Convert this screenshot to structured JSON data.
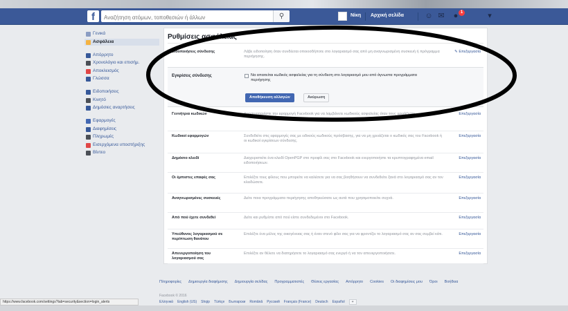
{
  "header": {
    "logo": "f",
    "search_placeholder": "Αναζήτηση ατόμων, τοποθεσιών ή άλλων",
    "search_icon": "⚲",
    "user_name": "Νίκη",
    "home_label": "Αρχική σελίδα",
    "notification_count": "1",
    "friends_icon": "☺",
    "messages_icon": "✉",
    "notifications_icon": "●",
    "lock_icon": "▾",
    "colors": {
      "bar": "#3b5998",
      "badge": "#fa3e3e"
    }
  },
  "leftnav": {
    "groups": [
      {
        "items": [
          {
            "label": "Γενικά",
            "color": "#8b9dc3"
          },
          {
            "label": "Ασφάλεια",
            "color": "#f5b341",
            "active": true
          }
        ]
      },
      {
        "items": [
          {
            "label": "Απόρρητο",
            "color": "#365899"
          },
          {
            "label": "Χρονολόγιο και επισήμ.",
            "color": "#4b4f56"
          },
          {
            "label": "Αποκλεισμός",
            "color": "#e04646"
          },
          {
            "label": "Γλώσσα",
            "color": "#365899"
          }
        ]
      },
      {
        "items": [
          {
            "label": "Ειδοποιήσεις",
            "color": "#365899"
          },
          {
            "label": "Κινητό",
            "color": "#4b4f56"
          },
          {
            "label": "Δημόσιες αναρτήσεις",
            "color": "#365899"
          }
        ]
      },
      {
        "items": [
          {
            "label": "Εφαρμογές",
            "color": "#4267b2"
          },
          {
            "label": "Διαφημίσεις",
            "color": "#365899"
          },
          {
            "label": "Πληρωμές",
            "color": "#4b4f56"
          },
          {
            "label": "Εισερχόμενα υποστήριξης",
            "color": "#e04646"
          },
          {
            "label": "Βίντεο",
            "color": "#4b4f56"
          }
        ]
      }
    ]
  },
  "main": {
    "title": "Ρυθμίσεις ασφάλειας",
    "edit_label": "Επεξεργασία",
    "top_row": {
      "label": "Ειδοποιήσεις σύνδεσης",
      "description": "Λάβε ειδοποίηση όταν συνδέεται οποιοσδήποτε στο λογαριασμό σας από μη αναγνωρισμένη συσκευή ή πρόγραμμα περιήγησης."
    },
    "expanded": {
      "label": "Εγκρίσεις σύνδεσης",
      "checkbox_text": "Να απαιτείται κωδικός ασφαλείας για τη σύνδεση στο λογαριασμό μου από άγνωστα προγράμματα περιήγησης",
      "save_label": "Αποθήκευση αλλαγών",
      "cancel_label": "Ακύρωση"
    },
    "rows": [
      {
        "label": "Γεννήτρια κωδικών",
        "description": "Χρησιμοποιήστε την εφαρμογή Facebook για να λαμβάνετε κωδικούς ασφαλείας όταν τους χρειάζεστε."
      },
      {
        "label": "Κωδικοί εφαρμογών",
        "description": "Συνδεθείτε στις εφαρμογές σας με ειδικούς κωδικούς πρόσβασης, για να μη χρειάζεται ο κωδικός σας του Facebook ή οι κωδικοί εγκρίσεων σύνδεσης."
      },
      {
        "label": "Δημόσιο κλειδί",
        "description": "Διαχειριστείτε ένα κλειδί OpenPGP στο προφίλ σας στο Facebook και ενεργοποιήστε τα κρυπτογραφημένα email ειδοποιήσεων."
      },
      {
        "label": "Οι έμπιστες επαφές σας",
        "description": "Επιλέξτε τους φίλους που μπορείτε να καλέσετε για να σας βοηθήσουν να συνδεθείτε ξανά στο λογαριασμό σας αν τον κλειδώσετε."
      },
      {
        "label": "Αναγνωρισμένες συσκευές",
        "description": "Δείτε ποια προγράμματα περιήγησης αποθηκεύσατε ως αυτά που χρησιμοποιείτε συχνά."
      },
      {
        "label": "Από πού έχετε συνδεθεί",
        "description": "Δείτε και ρυθμίστε από πού είστε συνδεδεμένοι στο Facebook."
      },
      {
        "label": "Υπεύθυνος λογαριασμού σε περίπτωση θανάτου",
        "description": "Επιλέξτε ένα μέλος της οικογένειας σας ή έναν στενό φίλο σας για να φροντίζει το λογαριασμό σας αν σας συμβεί κάτι."
      },
      {
        "label": "Απενεργοποίηση του λογαριασμού σας",
        "description": "Επιλέξτε αν θέλετε να διατηρήσετε το λογαριασμό σας ενεργό ή να τον απενεργοποιήσετε."
      }
    ]
  },
  "footer": {
    "links": [
      "Πληροφορίες",
      "Δημιουργία διαφήμισης",
      "Δημιουργία σελίδας",
      "Προγραμματιστές",
      "Θέσεις εργασίας",
      "Απόρρητο",
      "Cookies",
      "Οι διαφημίσεις μου",
      "Όροι",
      "Βοήθεια"
    ],
    "copyright": "Facebook © 2016",
    "languages": [
      "Ελληνικά",
      "English (US)",
      "Shqip",
      "Türkçe",
      "Български",
      "Română",
      "Русский",
      "Français (France)",
      "Deutsch",
      "Español"
    ],
    "more_languages": "+",
    "status_url": "https://www.facebook.com/settings?tab=security&section=login_alerts"
  }
}
